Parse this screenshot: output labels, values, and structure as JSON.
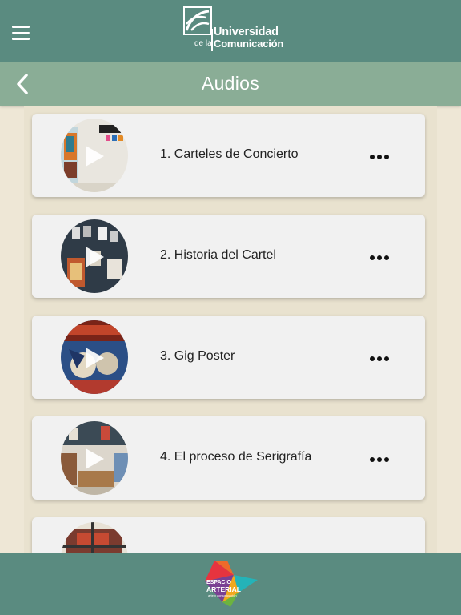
{
  "header": {
    "logo_line1": "Universidad",
    "logo_line2a": "de la",
    "logo_line2b": "Comunicación",
    "menu_icon": "hamburger-menu-icon",
    "background": "#5a8b80"
  },
  "subheader": {
    "title": "Audios",
    "back_icon": "chevron-left-icon",
    "background": "#8aad96"
  },
  "audios": [
    {
      "title": "1. Carteles de Concierto"
    },
    {
      "title": "2. Historia del Cartel"
    },
    {
      "title": "3. Gig Poster"
    },
    {
      "title": "4. El proceso de Serigrafía"
    },
    {
      "title": ""
    }
  ],
  "footer": {
    "logo_line1": "ESPACIO",
    "logo_line2": "ARTERIAL",
    "logo_line3": "arte y comunicación",
    "background": "#5a8b80"
  },
  "colors": {
    "page_background": "#eee7d6",
    "card_background": "#f1f1f1"
  }
}
